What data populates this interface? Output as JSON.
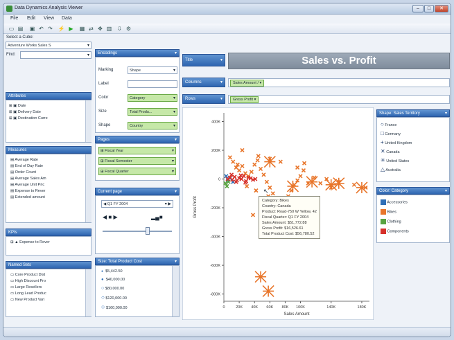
{
  "window": {
    "title": "Data Dynamics Analysis Viewer",
    "minimize": "–",
    "maximize": "□",
    "close": "✕"
  },
  "menu": [
    "File",
    "Edit",
    "View",
    "Data"
  ],
  "left": {
    "cube_label": "Select a Cube:",
    "cube_value": "Adventure Works Sales S",
    "find_label": "Find:",
    "attributes_title": "Attributes",
    "attributes": [
      "Date",
      "Delivery Date",
      "Destination Curre"
    ],
    "measures_title": "Measures",
    "measures": [
      "Average Rate",
      "End of Day Rate",
      "Order Count",
      "Average Sales Am",
      "Average Unit Pric",
      "Expense to Rever",
      "Extended amount"
    ],
    "kpis_title": "KPIs",
    "kpis": [
      "Expense to Rever"
    ],
    "named_sets_title": "Named Sets",
    "named_sets": [
      "Core Product Dist",
      "High Discount Pro",
      "Large Resellers",
      "Long Lead Produc",
      "New Product Vari"
    ]
  },
  "encodings": {
    "title": "Encodings",
    "marking_label": "Marking",
    "marking_value": "Shape",
    "label_label": "Label",
    "color_label": "Color",
    "color_value": "Category",
    "size_label": "Size",
    "size_value": "Total Produ...",
    "shape_label": "Shape",
    "shape_value": "Country"
  },
  "pages": {
    "title": "Pages",
    "items": [
      "Fiscal Year",
      "Fiscal Semester",
      "Fiscal Quarter"
    ]
  },
  "current_page": {
    "title": "Current page",
    "value": "Q1 FY 2004",
    "controls": [
      "◀",
      "■",
      "▶"
    ]
  },
  "size_legend": {
    "title": "Size: Total Product Cost",
    "items": [
      "$5,442.50",
      "$40,000.00",
      "$80,000.00",
      "$120,000.00",
      "$160,000.00"
    ]
  },
  "shelves": {
    "title_btn": "Title",
    "chart_title": "Sales vs. Profit",
    "columns_btn": "Columns",
    "columns_pill": "Sales Amount",
    "rows_btn": "Rows",
    "rows_pill": "Gross Profit"
  },
  "chart_data": {
    "type": "scatter",
    "title": "Sales vs. Profit",
    "xlabel": "Sales Amount",
    "ylabel": "Gross Profit",
    "xlim": [
      0,
      190000
    ],
    "ylim": [
      -850000,
      460000
    ],
    "xticks": [
      "0",
      "20K",
      "40K",
      "60K",
      "80K",
      "100K",
      "140K",
      "180K"
    ],
    "yticks": [
      "400K",
      "200K",
      "0",
      "-200K",
      "-400K",
      "-600K",
      "-800K"
    ],
    "series": [
      {
        "name": "Accessories",
        "color": "#2f6fb7",
        "x": [
          3000,
          5000,
          8000,
          12000
        ],
        "y": [
          20000,
          -10000,
          5000,
          -20000
        ]
      },
      {
        "name": "Bikes",
        "color": "#e8752a",
        "x": [
          8000,
          12000,
          16000,
          20000,
          24000,
          28000,
          32000,
          36000,
          40000,
          44000,
          48000,
          52000,
          56000,
          60000,
          64000,
          68000,
          72000,
          76000,
          80000,
          84000,
          88000,
          92000,
          96000,
          100000,
          104000,
          110000,
          118000,
          126000,
          134000,
          140000,
          150000,
          170000,
          185000,
          38000,
          52000,
          66000,
          24000,
          18000,
          30000,
          42000,
          58000,
          74000,
          45000,
          60000,
          96000,
          105000
        ],
        "y": [
          150000,
          120000,
          80000,
          60000,
          90000,
          40000,
          20000,
          50000,
          100000,
          130000,
          70000,
          30000,
          -20000,
          -60000,
          -100000,
          -140000,
          -180000,
          -220000,
          -160000,
          -120000,
          -80000,
          -40000,
          -10000,
          20000,
          60000,
          -30000,
          10000,
          -30000,
          0,
          -60000,
          -20000,
          -40000,
          -60000,
          -250000,
          -300000,
          -200000,
          200000,
          100000,
          -50000,
          -80000,
          -120000,
          120000,
          160000,
          140000,
          80000,
          110000
        ]
      },
      {
        "name": "Clothing",
        "color": "#58a341",
        "x": [
          2000,
          4000,
          6000
        ],
        "y": [
          -30000,
          -50000,
          -20000
        ]
      },
      {
        "name": "Components",
        "color": "#d6312b",
        "x": [
          5000,
          8000,
          11000,
          14000,
          17000,
          20000,
          23000,
          26000,
          29000,
          32000,
          35000,
          38000,
          41000,
          10000,
          16000,
          22000,
          28000
        ],
        "y": [
          0,
          10000,
          -5000,
          15000,
          -10000,
          5000,
          0,
          20000,
          -15000,
          10000,
          5000,
          -5000,
          0,
          30000,
          -20000,
          25000,
          -25000
        ]
      }
    ],
    "big_markers": [
      {
        "x": 60000,
        "y": 120000
      },
      {
        "x": 90000,
        "y": -50000
      },
      {
        "x": 115000,
        "y": -20000
      },
      {
        "x": 140000,
        "y": -40000
      },
      {
        "x": 150000,
        "y": -30000
      },
      {
        "x": 180000,
        "y": -60000
      },
      {
        "x": 48000,
        "y": -680000
      },
      {
        "x": 58000,
        "y": -780000
      }
    ]
  },
  "tooltip": {
    "lines": [
      "Category: Bikes",
      "Country: Canada",
      "Product: Road-750 W Yellow, 42",
      "Fiscal Quarter: Q1 FY 2004",
      "Sales Amount: $51,772.88",
      "Gross Profit: $16,526.61",
      "Total Product Cost: $56,780.52"
    ]
  },
  "shape_legend": {
    "title": "Shape: Sales Territory",
    "items": [
      {
        "icon": "circle-icon",
        "label": "France"
      },
      {
        "icon": "square-icon",
        "label": "Germany"
      },
      {
        "icon": "plus-icon",
        "label": "United Kingdom"
      },
      {
        "icon": "x-icon",
        "label": "Canada"
      },
      {
        "icon": "asterisk-icon",
        "label": "United States"
      },
      {
        "icon": "triangle-icon",
        "label": "Australia"
      }
    ]
  },
  "color_legend": {
    "title": "Color: Category",
    "items": [
      {
        "label": "Accessories",
        "color": "#2f6fb7"
      },
      {
        "label": "Bikes",
        "color": "#e8752a"
      },
      {
        "label": "Clothing",
        "color": "#58a341"
      },
      {
        "label": "Components",
        "color": "#d6312b"
      }
    ]
  }
}
